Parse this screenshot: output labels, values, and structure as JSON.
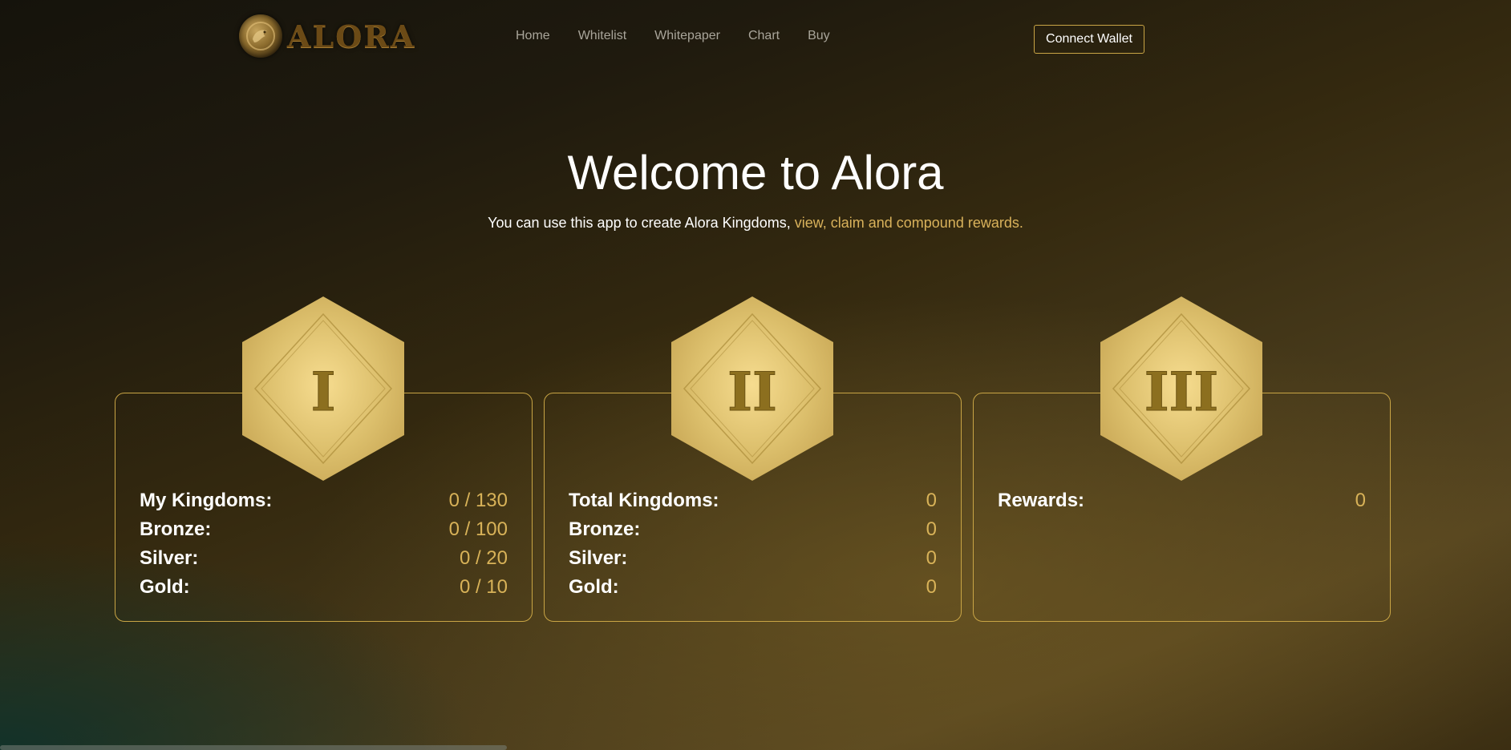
{
  "header": {
    "logo_text": "ALORA",
    "nav": [
      "Home",
      "Whitelist",
      "Whitepaper",
      "Chart",
      "Buy"
    ],
    "connect_wallet": "Connect Wallet"
  },
  "hero": {
    "title": "Welcome to Alora",
    "subtitle_plain": "You can use this app to create Alora Kingdoms,",
    "subtitle_highlight": "view, claim and compound rewards."
  },
  "colors": {
    "accent_gold": "#d8b258",
    "border_gold": "#c9a545",
    "hexagon_gold": "#dcc073",
    "numeral_color": "#8c6f1f"
  },
  "cards": [
    {
      "numeral": "I",
      "rows": [
        {
          "label": "My Kingdoms:",
          "value": "0 / 130"
        },
        {
          "label": "Bronze:",
          "value": "0 / 100"
        },
        {
          "label": "Silver:",
          "value": "0 / 20"
        },
        {
          "label": "Gold:",
          "value": "0 / 10"
        }
      ]
    },
    {
      "numeral": "II",
      "rows": [
        {
          "label": "Total Kingdoms:",
          "value": "0"
        },
        {
          "label": "Bronze:",
          "value": "0"
        },
        {
          "label": "Silver:",
          "value": "0"
        },
        {
          "label": "Gold:",
          "value": "0"
        }
      ]
    },
    {
      "numeral": "III",
      "rows": [
        {
          "label": "Rewards:",
          "value": "0"
        }
      ]
    }
  ],
  "icons": {
    "logo": "dragon-emblem-icon",
    "card_badge": "hexagon-badge-icon"
  }
}
